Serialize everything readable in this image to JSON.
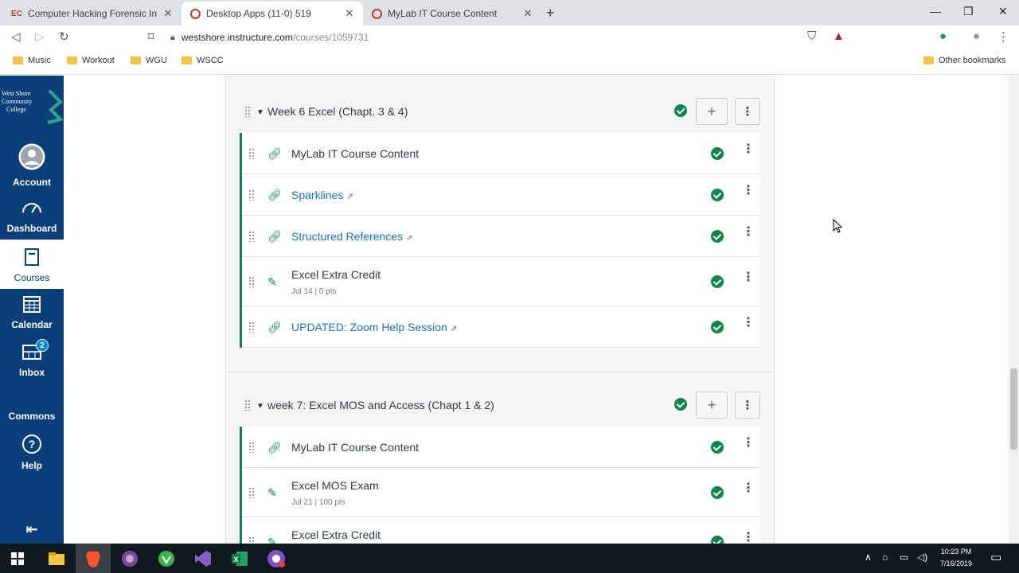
{
  "browser": {
    "tabs": [
      {
        "title": "Computer Hacking Forensic Inve...",
        "active": false
      },
      {
        "title": "Desktop Apps (11-0) 519",
        "active": true
      },
      {
        "title": "MyLab IT Course Content",
        "active": false
      }
    ],
    "address": {
      "host": "westshore.instructure.com",
      "path": "/courses/1059731"
    },
    "bookmarks": [
      "Music",
      "Workout",
      "WGU",
      "WSCC"
    ],
    "other_bookmarks": "Other bookmarks"
  },
  "global_nav": {
    "logo_text": "West Shore Community College",
    "items": [
      {
        "label": "Account",
        "icon": "account-icon"
      },
      {
        "label": "Dashboard",
        "icon": "dashboard-icon"
      },
      {
        "label": "Courses",
        "icon": "courses-icon",
        "active": true
      },
      {
        "label": "Calendar",
        "icon": "calendar-icon"
      },
      {
        "label": "Inbox",
        "icon": "inbox-icon",
        "badge": "2"
      },
      {
        "label": "Commons",
        "icon": "commons-icon"
      },
      {
        "label": "Help",
        "icon": "help-icon"
      }
    ]
  },
  "modules": [
    {
      "title": "Week 6 Excel (Chapt. 3 & 4)",
      "items": [
        {
          "title": "MyLab IT Course Content",
          "type": "link",
          "style": "plain",
          "external": false
        },
        {
          "title": "Sparklines",
          "type": "link",
          "style": "link",
          "external": true
        },
        {
          "title": "Structured References",
          "type": "link",
          "style": "link",
          "external": true
        },
        {
          "title": "Excel Extra Credit",
          "type": "assignment",
          "style": "plain",
          "meta": "Jul 14 | 0 pts"
        },
        {
          "title": "UPDATED: Zoom Help Session",
          "type": "link",
          "style": "link",
          "external": true
        }
      ]
    },
    {
      "title": "week 7: Excel MOS and Access (Chapt 1 & 2)",
      "items": [
        {
          "title": "MyLab IT Course Content",
          "type": "link",
          "style": "plain",
          "external": false
        },
        {
          "title": "Excel MOS Exam",
          "type": "assignment",
          "style": "plain",
          "meta": "Jul 21 | 100 pts"
        },
        {
          "title": "Excel Extra Credit",
          "type": "assignment",
          "style": "plain",
          "meta": ""
        }
      ]
    }
  ],
  "taskbar": {
    "time": "10:23 PM",
    "date": "7/16/2019"
  },
  "colors": {
    "nav": "#0b3f7a",
    "published": "#0b874b",
    "link": "#1a73b5"
  }
}
